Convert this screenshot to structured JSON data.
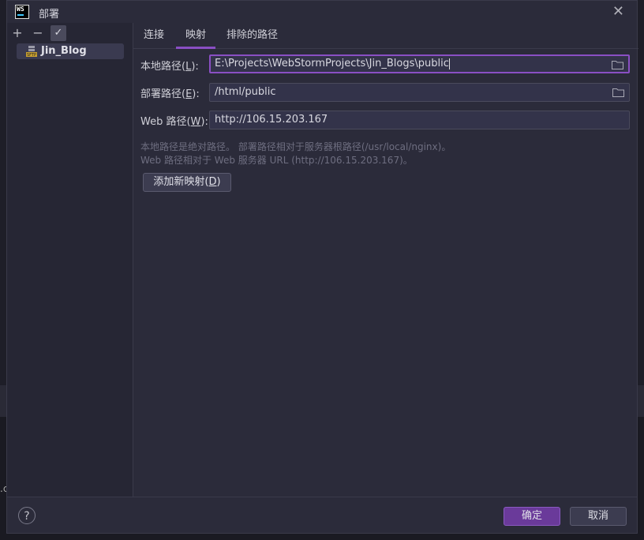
{
  "window": {
    "title": "部署",
    "app_icon_text": "WS"
  },
  "toolbar": {
    "add": "+",
    "remove": "−",
    "check": "✓"
  },
  "servers": [
    {
      "name": "Jin_Blog",
      "icon": "sftp-icon"
    }
  ],
  "tabs": [
    {
      "label": "连接",
      "active": false
    },
    {
      "label": "映射",
      "active": true
    },
    {
      "label": "排除的路径",
      "active": false
    }
  ],
  "mapping": {
    "local_label_prefix": "本地路径(",
    "local_label_mnemonic": "L",
    "local_label_suffix": "):",
    "local_value": "E:\\Projects\\WebStormProjects\\Jin_Blogs\\public",
    "deploy_label_prefix": "部署路径(",
    "deploy_label_mnemonic": "E",
    "deploy_label_suffix": "):",
    "deploy_value": "/html/public",
    "web_label_prefix": "Web 路径(",
    "web_label_mnemonic": "W",
    "web_label_suffix": "):",
    "web_value": "http://106.15.203.167",
    "hint_line1": "本地路径是绝对路径。 部署路径相对于服务器根路径(/usr/local/nginx)。",
    "hint_line2": "Web 路径相对于 Web 服务器 URL (http://106.15.203.167)。",
    "add_mapping_prefix": "添加新映射(",
    "add_mapping_mnemonic": "D",
    "add_mapping_suffix": ")"
  },
  "footer": {
    "help": "?",
    "ok": "确定",
    "cancel": "取消"
  },
  "colors": {
    "accent": "#8a4fc4",
    "primary_button": "#6a3a9a",
    "dialog_bg": "#2b2b3a"
  }
}
